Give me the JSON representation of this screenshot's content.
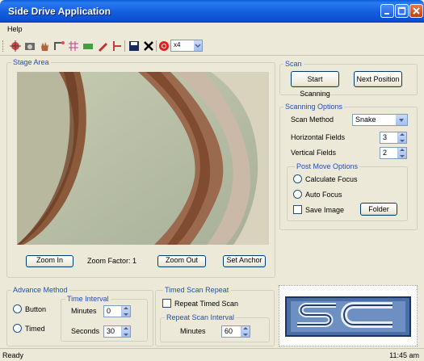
{
  "window": {
    "title": "Side Drive Application"
  },
  "menu": {
    "help": "Help"
  },
  "toolbar": {
    "icons": [
      "crosshair-icon",
      "camera-icon",
      "hand-icon",
      "measure-icon",
      "grid-icon",
      "stage-icon",
      "pen-icon",
      "ruler-icon",
      "save-icon",
      "delete-icon",
      "stop-icon"
    ],
    "zoom_value": "x4"
  },
  "stage": {
    "label": "Stage Area",
    "zoom_in": "Zoom In",
    "zoom_factor": "Zoom Factor: 1",
    "zoom_out": "Zoom Out",
    "set_anchor": "Set Anchor"
  },
  "scan": {
    "label": "Scan",
    "start": "Start Scanning",
    "next": "Next Position"
  },
  "scanning_options": {
    "label": "Scanning Options",
    "method_label": "Scan Method",
    "method_value": "Snake",
    "horizontal_label": "Horizontal Fields",
    "horizontal_value": "3",
    "vertical_label": "Vertical Fields",
    "vertical_value": "2",
    "post_move": {
      "label": "Post Move Options",
      "calculate_focus": "Calculate Focus",
      "auto_focus": "Auto Focus",
      "save_image": "Save Image",
      "folder": "Folder"
    }
  },
  "advance": {
    "label": "Advance Method",
    "button": "Button",
    "timed": "Timed",
    "time_interval": {
      "label": "Time Interval",
      "minutes_label": "Minutes",
      "minutes_value": "0",
      "seconds_label": "Seconds",
      "seconds_value": "30"
    }
  },
  "timed_repeat": {
    "label": "Timed Scan Repeat",
    "repeat_label": "Repeat Timed Scan",
    "interval": {
      "label": "Repeat Scan Interval",
      "minutes_label": "Minutes",
      "minutes_value": "60"
    }
  },
  "status": {
    "left": "Ready",
    "time": "11:45 am"
  },
  "colors": {
    "accent": "#1f4fb2",
    "titlebar": "#0a5cd8"
  }
}
